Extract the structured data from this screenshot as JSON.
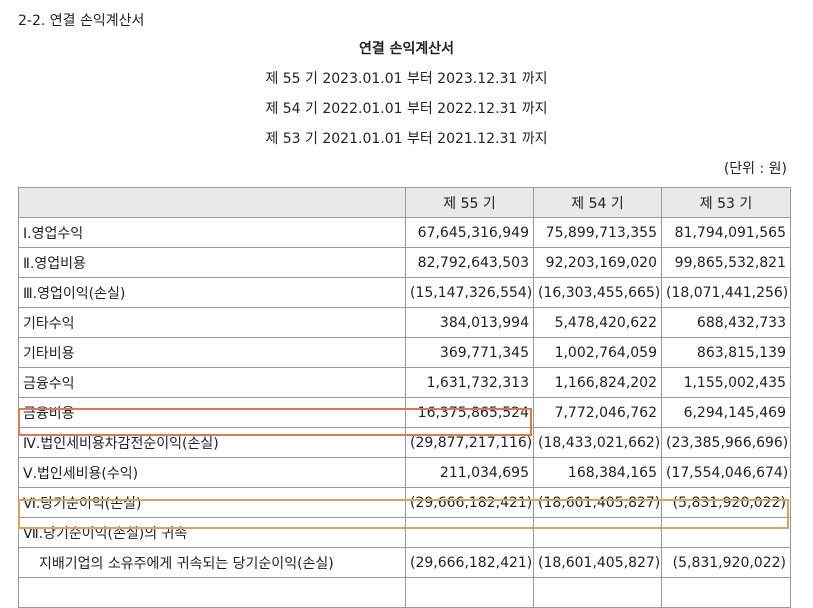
{
  "section_title": "2-2. 연결 손익계산서",
  "doc_title": "연결 손익계산서",
  "periods": [
    "제 55 기 2023.01.01 부터 2023.12.31 까지",
    "제 54 기 2022.01.01 부터 2022.12.31 까지",
    "제 53 기 2021.01.01 부터 2021.12.31 까지"
  ],
  "unit": "(단위 : 원)",
  "table": {
    "headers": [
      "",
      "제 55 기",
      "제 54 기",
      "제 53 기"
    ],
    "rows": [
      {
        "label": "Ⅰ.영업수익",
        "v55": "67,645,316,949",
        "v54": "75,899,713,355",
        "v53": "81,794,091,565"
      },
      {
        "label": "Ⅱ.영업비용",
        "v55": "82,792,643,503",
        "v54": "92,203,169,020",
        "v53": "99,865,532,821"
      },
      {
        "label": "Ⅲ.영업이익(손실)",
        "v55": "(15,147,326,554)",
        "v54": "(16,303,455,665)",
        "v53": "(18,071,441,256)"
      },
      {
        "label": "기타수익",
        "v55": "384,013,994",
        "v54": "5,478,420,622",
        "v53": "688,432,733"
      },
      {
        "label": "기타비용",
        "v55": "369,771,345",
        "v54": "1,002,764,059",
        "v53": "863,815,139"
      },
      {
        "label": "금융수익",
        "v55": "1,631,732,313",
        "v54": "1,166,824,202",
        "v53": "1,155,002,435"
      },
      {
        "label": "금융비용",
        "v55": "16,375,865,524",
        "v54": "7,772,046,762",
        "v53": "6,294,145,469"
      },
      {
        "label": "Ⅳ.법인세비용차감전순이익(손실)",
        "v55": "(29,877,217,116)",
        "v54": "(18,433,021,662)",
        "v53": "(23,385,966,696)"
      },
      {
        "label": "Ⅴ.법인세비용(수익)",
        "v55": "211,034,695",
        "v54": "168,384,165",
        "v53": "(17,554,046,674)"
      },
      {
        "label": "Ⅵ.당기순이익(손실)",
        "v55": "(29,666,182,421)",
        "v54": "(18,601,405,827)",
        "v53": "(5,831,920,022)"
      },
      {
        "label": "Ⅶ.당기순이익(손실)의 귀속",
        "v55": "",
        "v54": "",
        "v53": ""
      },
      {
        "label": "지배기업의 소유주에게 귀속되는 당기순이익(손실)",
        "v55": "(29,666,182,421)",
        "v54": "(18,601,405,827)",
        "v53": "(5,831,920,022)"
      },
      {
        "label": "",
        "v55": "",
        "v54": "",
        "v53": ""
      }
    ]
  },
  "colors": {
    "highlight_red": "#d97a55",
    "highlight_orange": "#e0a060",
    "header_bg": "#e9e9e9"
  }
}
